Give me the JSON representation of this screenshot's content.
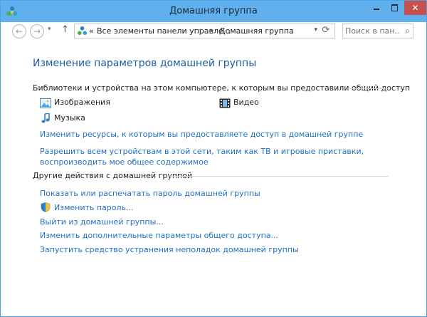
{
  "window": {
    "title": "Домашняя группа",
    "close_glyph": "✕"
  },
  "nav": {
    "back_icon": "←",
    "forward_icon": "→",
    "recent_icon": "▾",
    "up_icon": "↑",
    "address": {
      "prefix": "«",
      "crumb1": "Все элементы панели управле...",
      "sep1": "▸",
      "crumb2": "Домашняя группа",
      "dropdown": "▾",
      "refresh": "⟳"
    },
    "search": {
      "placeholder": "Поиск в пан...",
      "icon": "⌕"
    }
  },
  "main": {
    "title": "Изменение параметров домашней группы",
    "section1": {
      "heading": "Библиотеки и устройства на этом компьютере, к которым вы предоставили общий доступ",
      "items": [
        {
          "label": "Изображения",
          "icon": "pictures-icon"
        },
        {
          "label": "Видео",
          "icon": "video-icon"
        },
        {
          "label": "Музыка",
          "icon": "music-icon"
        }
      ],
      "links": [
        "Изменить ресурсы, к которым вы предоставляете доступ в домашней группе",
        "Разрешить всем устройствам в этой сети, таким как ТВ и игровые приставки, воспроизводить мое общее содержимое"
      ]
    },
    "section2": {
      "heading": "Другие действия с домашней группой",
      "links": [
        "Показать или распечатать пароль домашней группы",
        "Изменить пароль...",
        "Выйти из домашней группы...",
        "Изменить дополнительные параметры общего доступа...",
        "Запустить средство устранения неполадок домашней группы"
      ]
    }
  },
  "colors": {
    "titlebar": "#5fb0ec",
    "link": "#1f6fc5",
    "heading": "#1d5ba8",
    "close": "#c7504f"
  }
}
